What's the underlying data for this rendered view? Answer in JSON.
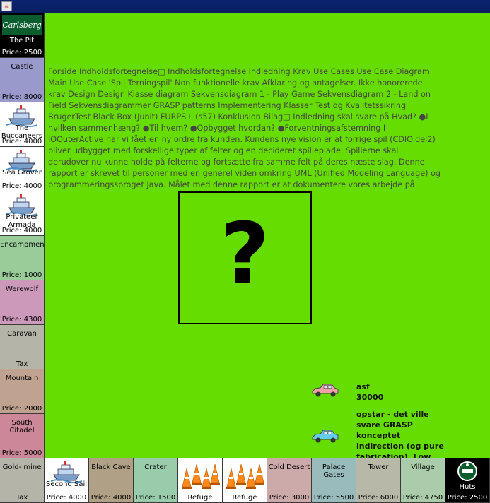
{
  "window": {
    "icon": "java-icon"
  },
  "description_text": "Forside    Indholdsfortegnelse□ Indholdsfortegnelse Indledning Krav Use Cases Use Case Diagram Main Use Case 'Spil Terningspil' Non funktionelle krav Afklaring og antagelser. Ikke honorerede krav Design Design Klasse diagram Sekvensdiagram 1 - Play Game Sekvensdiagram 2 - Land on Field Sekvensdiagrammer GRASP patterns Implementering Klasser Test og Kvalitetssikring BrugerTest Black Box (Junit) FURPS+ (s57) Konklusion Bilag□      Indledning  skal svare på  Hvad? ●I hvilken sammenhæng? ●Til hvem? ●Opbygget hvordan? ●Forventningsafstemning   I IOOuterActive har vi fået en ny ordre fra kunden. Kundens nye vision er at forrige spil (CDIO.del2) bliver udbygget med forskellige typer af felter og en decideret spilleplade. Spillerne skal derudover nu kunne holde på felterne og fortsætte fra samme felt på deres næste slag.   Denne rapport er skrevet til personer med en generel viden omkring UML (Unified Modeling Language) og programmeringssproget Java. Målet med denne rapport er at dokumentere vores arbejde på denne ordre i IOOuterActive, så vi har et",
  "center": {
    "symbol": "?"
  },
  "left_fields": [
    {
      "name": "The Pit",
      "price": "Price: 2500",
      "bg": "#000000",
      "dark": true,
      "logo": "carlsberg-logo",
      "logo_text": "Carlsberg"
    },
    {
      "name": "Castle",
      "price": "Price: 8000",
      "bg": "#9999cc"
    },
    {
      "name": "The Buccaneers",
      "price": "Price: 4000",
      "bg": "#ffffff",
      "logo": "ship-icon"
    },
    {
      "name": "Sea Grover",
      "price": "Price: 4000",
      "bg": "#ffffff",
      "logo": "ship-icon"
    },
    {
      "name": "Privateer Armada",
      "price": "Price: 4000",
      "bg": "#ffffff",
      "logo": "ship-icon"
    },
    {
      "name": "Encampment",
      "price": "Price: 1000",
      "bg": "#99cc99"
    },
    {
      "name": "Werewolf",
      "price": "Price: 4300",
      "bg": "#cc99bb"
    },
    {
      "name": "Caravan",
      "price": "Tax",
      "bg": "#b4b4a8"
    },
    {
      "name": "Mountain",
      "price": "Price: 2000",
      "bg": "#bfa390"
    },
    {
      "name": "South Citadel",
      "price": "Price: 5000",
      "bg": "#cc8899"
    }
  ],
  "bottom_fields": [
    {
      "name": "Gold- mine",
      "price": "Tax",
      "bg": "#b4b4a8"
    },
    {
      "name": "Second Sail",
      "price": "Price: 4000",
      "bg": "#ffffff",
      "logo": "ship-icon"
    },
    {
      "name": "Black Cave",
      "price": "Price: 4000",
      "bg": "#b0a085"
    },
    {
      "name": "Crater",
      "price": "Price: 1500",
      "bg": "#99ccaa"
    },
    {
      "name": "Refuge",
      "price": "",
      "bg": "#ffffff",
      "logo": "traffic-cones-icon"
    },
    {
      "name": "Refuge",
      "price": "",
      "bg": "#ffffff",
      "logo": "traffic-cones-icon"
    },
    {
      "name": "Cold Desert",
      "price": "Price: 3000",
      "bg": "#ccaaaa"
    },
    {
      "name": "Palace Gates",
      "price": "Price: 5500",
      "bg": "#99bbbb"
    },
    {
      "name": "Tower",
      "price": "Price: 6000",
      "bg": "#b8b8a8"
    },
    {
      "name": "Village",
      "price": "Price: 4750",
      "bg": "#aaccaa"
    },
    {
      "name": "Huts",
      "price": "Price: 2500",
      "bg": "#000000",
      "dark": true,
      "logo": "tuborg-logo"
    }
  ],
  "players": [
    {
      "name": "asf",
      "balance": "30000",
      "car_color": "#f4a0a8",
      "icon": "car-icon"
    },
    {
      "name": "opstar - det ville svare GRASP konceptet indirection (og pure fabrication). Low Coupling er opnået ved",
      "balance": "",
      "car_color": "#66ccee",
      "icon": "car-icon"
    }
  ]
}
